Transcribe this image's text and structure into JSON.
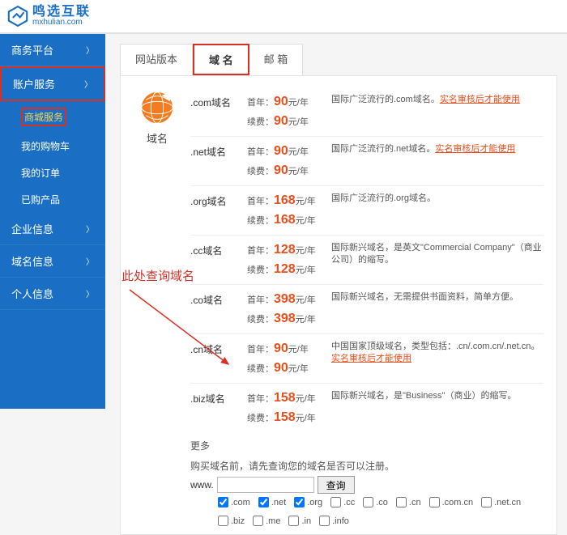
{
  "brand": {
    "cn": "鸣选互联",
    "en": "mxhulian.com"
  },
  "sidebar": {
    "items": [
      {
        "label": "商务平台",
        "expandable": true
      },
      {
        "label": "账户服务",
        "expandable": true,
        "highlightBox": true,
        "children": [
          {
            "label": "商城服务",
            "highlight": true,
            "box": true
          },
          {
            "label": "我的购物车"
          },
          {
            "label": "我的订单"
          },
          {
            "label": "已购产品"
          }
        ]
      },
      {
        "label": "企业信息",
        "expandable": true
      },
      {
        "label": "域名信息",
        "expandable": true
      },
      {
        "label": "个人信息",
        "expandable": true
      }
    ]
  },
  "tabs": [
    {
      "label": "网站版本"
    },
    {
      "label": "域 名",
      "active": true
    },
    {
      "label": "邮 箱"
    }
  ],
  "domainIconLabel": "域名",
  "priceLabels": {
    "first": "首年：",
    "renew": "续费：",
    "unit": "元/年"
  },
  "domains": [
    {
      "ext": ".com域名",
      "first": "90",
      "renew": "90",
      "desc": "国际广泛流行的.com域名。",
      "link": "实名审核后才能使用"
    },
    {
      "ext": ".net域名",
      "first": "90",
      "renew": "90",
      "desc": "国际广泛流行的.net域名。",
      "link": "实名审核后才能使用"
    },
    {
      "ext": ".org域名",
      "first": "168",
      "renew": "168",
      "desc": "国际广泛流行的.org域名。"
    },
    {
      "ext": ".cc域名",
      "first": "128",
      "renew": "128",
      "desc": "国际新兴域名，是英文\"Commercial Company\"（商业公司）的缩写。"
    },
    {
      "ext": ".co域名",
      "first": "398",
      "renew": "398",
      "desc": "国际新兴域名，无需提供书面资料，简单方便。"
    },
    {
      "ext": ".cn域名",
      "first": "90",
      "renew": "90",
      "desc": "中国国家顶级域名，类型包括：.cn/.com.cn/.net.cn。",
      "link": "实名审核后才能使用"
    },
    {
      "ext": ".biz域名",
      "first": "158",
      "renew": "158",
      "desc": "国际新兴域名，是\"Business\"（商业）的缩写。"
    }
  ],
  "moreLabel": "更多",
  "query": {
    "tip": "购买域名前，请先查询您的域名是否可以注册。",
    "prefix": "www.",
    "placeholder": "",
    "button": "查询",
    "checks": [
      {
        "label": ".com",
        "checked": true
      },
      {
        "label": ".net",
        "checked": true
      },
      {
        "label": ".org",
        "checked": true
      },
      {
        "label": ".cc",
        "checked": false
      },
      {
        "label": ".co",
        "checked": false
      },
      {
        "label": ".cn",
        "checked": false
      },
      {
        "label": ".com.cn",
        "checked": false
      },
      {
        "label": ".net.cn",
        "checked": false
      },
      {
        "label": ".biz",
        "checked": false
      },
      {
        "label": ".me",
        "checked": false
      },
      {
        "label": ".in",
        "checked": false
      },
      {
        "label": ".info",
        "checked": false
      }
    ]
  },
  "annotation": "此处查询域名"
}
